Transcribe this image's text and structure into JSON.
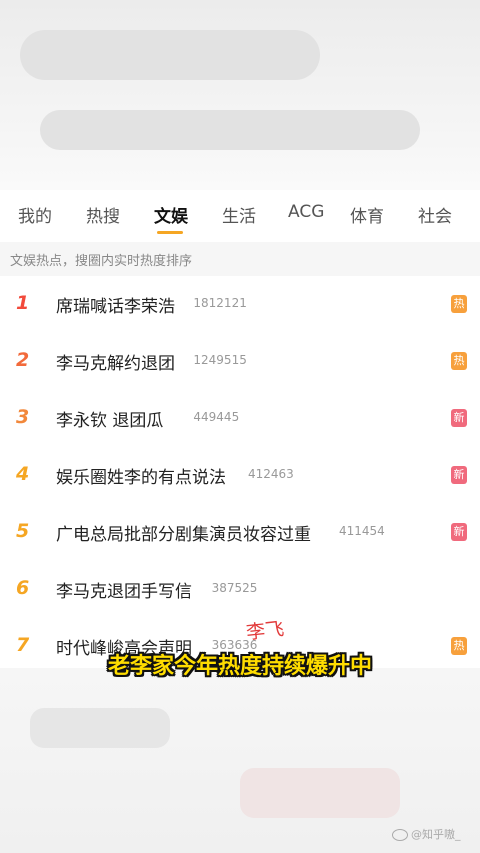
{
  "tabs": [
    {
      "label": "我的"
    },
    {
      "label": "热搜"
    },
    {
      "label": "文娱"
    },
    {
      "label": "生活"
    },
    {
      "label": "ACG"
    },
    {
      "label": "体育"
    },
    {
      "label": "社会"
    }
  ],
  "active_tab": "文娱",
  "subheader": "文娱热点，搜圈内实时热度排序",
  "list": [
    {
      "rank": "1",
      "title": "席瑞喊话李荣浩",
      "count": "1812121",
      "badge": "热",
      "badge_type": "hot",
      "rank_color": "#f24a3b"
    },
    {
      "rank": "2",
      "title": "李马克解约退团",
      "count": "1249515",
      "badge": "热",
      "badge_type": "hot",
      "rank_color": "#f26a3b"
    },
    {
      "rank": "3",
      "title": "李永钦 退团瓜",
      "count": "449445",
      "badge": "新",
      "badge_type": "new",
      "rank_color": "#f2883b"
    },
    {
      "rank": "4",
      "title": "娱乐圈姓李的有点说法",
      "count": "412463",
      "badge": "新",
      "badge_type": "new",
      "rank_color": "#f5a623"
    },
    {
      "rank": "5",
      "title": "广电总局批部分剧集演员妆容过重",
      "count": "411454",
      "badge": "新",
      "badge_type": "new",
      "rank_color": "#f5a623"
    },
    {
      "rank": "6",
      "title": "李马克退团手写信",
      "count": "387525",
      "badge": "",
      "badge_type": "",
      "rank_color": "#f5a623"
    },
    {
      "rank": "7",
      "title": "时代峰峻高会声明",
      "count": "363636",
      "badge": "热",
      "badge_type": "hot",
      "rank_color": "#f5a623"
    }
  ],
  "caption": "老李家今年热度持续爆升中",
  "handwritten_note": "李飞",
  "watermark": "@知乎嗷_"
}
